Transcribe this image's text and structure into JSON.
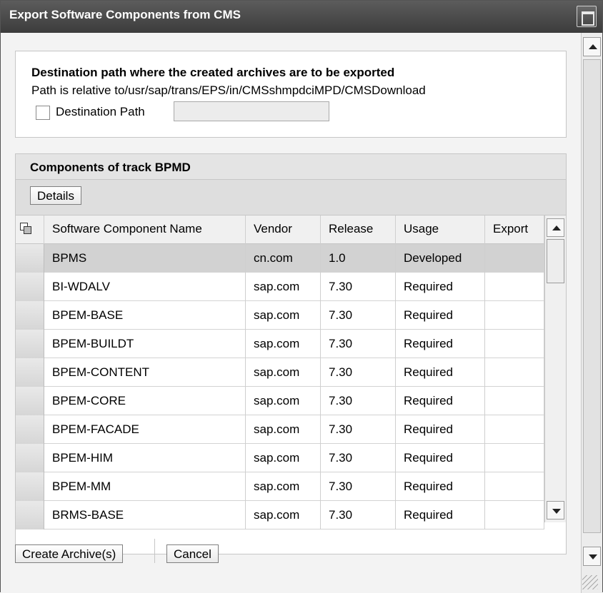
{
  "window": {
    "title": "Export Software Components from CMS"
  },
  "destination": {
    "heading": "Destination path where the created archives are to be exported",
    "note": "Path is relative to/usr/sap/trans/EPS/in/CMSshmpdciMPD/CMSDownload",
    "checkbox_label": "Destination Path",
    "checkbox_checked": false,
    "input_value": ""
  },
  "components": {
    "header": "Components of track BPMD",
    "details_button": "Details",
    "columns": [
      "Software Component Name",
      "Vendor",
      "Release",
      "Usage",
      "Export"
    ],
    "rows": [
      {
        "name": "BPMS",
        "vendor": "cn.com",
        "release": "1.0",
        "usage": "Developed",
        "export": "",
        "selected": true
      },
      {
        "name": "BI-WDALV",
        "vendor": "sap.com",
        "release": "7.30",
        "usage": "Required",
        "export": ""
      },
      {
        "name": "BPEM-BASE",
        "vendor": "sap.com",
        "release": "7.30",
        "usage": "Required",
        "export": ""
      },
      {
        "name": "BPEM-BUILDT",
        "vendor": "sap.com",
        "release": "7.30",
        "usage": "Required",
        "export": ""
      },
      {
        "name": "BPEM-CONTENT",
        "vendor": "sap.com",
        "release": "7.30",
        "usage": "Required",
        "export": ""
      },
      {
        "name": "BPEM-CORE",
        "vendor": "sap.com",
        "release": "7.30",
        "usage": "Required",
        "export": ""
      },
      {
        "name": "BPEM-FACADE",
        "vendor": "sap.com",
        "release": "7.30",
        "usage": "Required",
        "export": ""
      },
      {
        "name": "BPEM-HIM",
        "vendor": "sap.com",
        "release": "7.30",
        "usage": "Required",
        "export": ""
      },
      {
        "name": "BPEM-MM",
        "vendor": "sap.com",
        "release": "7.30",
        "usage": "Required",
        "export": ""
      },
      {
        "name": "BRMS-BASE",
        "vendor": "sap.com",
        "release": "7.30",
        "usage": "Required",
        "export": ""
      }
    ]
  },
  "actions": {
    "create_label": "Create Archive(s)",
    "cancel_label": "Cancel"
  },
  "icons": {
    "window_menu": "window-menu-icon",
    "select_all": "select-all-icon",
    "scroll_up": "scroll-up-arrow-icon",
    "scroll_down": "scroll-down-arrow-icon",
    "resize": "resize-grip-icon"
  }
}
